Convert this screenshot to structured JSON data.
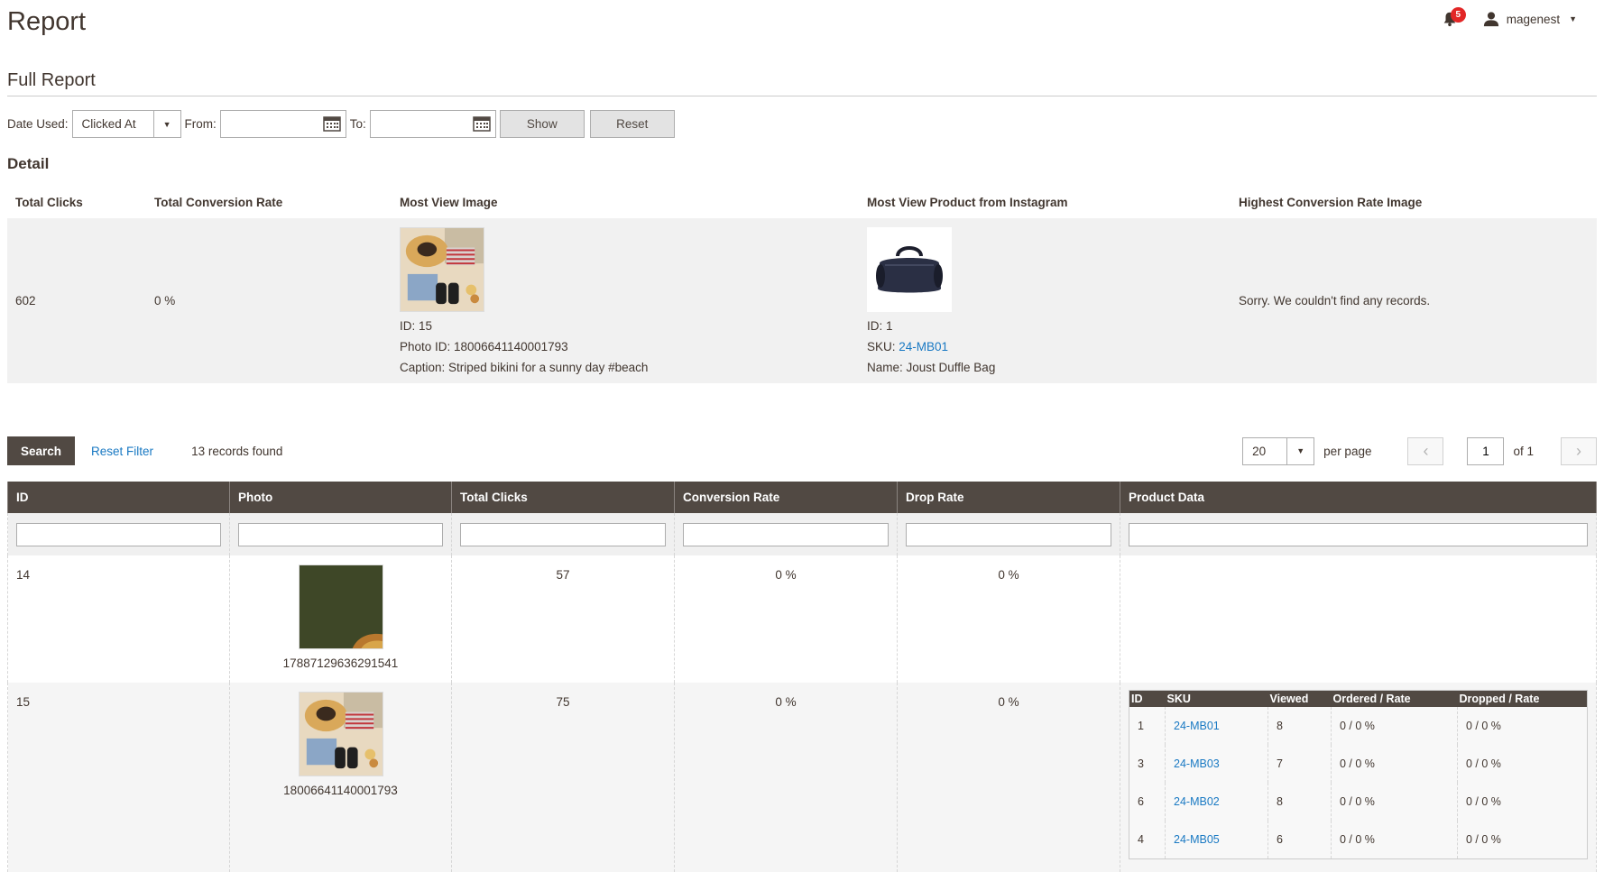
{
  "header": {
    "title": "Report",
    "notification_count": "5",
    "username": "magenest"
  },
  "section": {
    "title": "Full Report"
  },
  "filters": {
    "date_used_label": "Date Used:",
    "date_used_value": "Clicked At",
    "from_label": "From:",
    "from_value": "",
    "to_label": "To:",
    "to_value": "",
    "show_label": "Show",
    "reset_label": "Reset"
  },
  "detail": {
    "title": "Detail",
    "headers": {
      "total_clicks": "Total Clicks",
      "total_conversion_rate": "Total Conversion Rate",
      "most_view_image": "Most View Image",
      "most_view_product": "Most View Product from Instagram",
      "highest_conversion": "Highest Conversion Rate Image"
    },
    "total_clicks": "602",
    "total_conversion_rate": "0 %",
    "most_view_image": {
      "id": "ID: 15",
      "photo_id": "Photo ID: 18006641140001793",
      "caption": "Caption: Striped bikini for a sunny day #beach"
    },
    "most_view_product": {
      "id": "ID: 1",
      "sku_label": "SKU: ",
      "sku": "24-MB01",
      "name": "Name: Joust Duffle Bag"
    },
    "highest_conversion": "Sorry. We couldn't find any records."
  },
  "grid_toolbar": {
    "search_label": "Search",
    "reset_filter_label": "Reset Filter",
    "records_found": "13 records found",
    "per_page_value": "20",
    "per_page_label": "per page",
    "page_value": "1",
    "of_label": "of 1"
  },
  "grid": {
    "columns": [
      "ID",
      "Photo",
      "Total Clicks",
      "Conversion Rate",
      "Drop Rate",
      "Product Data"
    ],
    "rows": [
      {
        "id": "14",
        "photo_id": "17887129636291541",
        "total_clicks": "57",
        "conversion_rate": "0 %",
        "drop_rate": "0 %"
      },
      {
        "id": "15",
        "photo_id": "18006641140001793",
        "total_clicks": "75",
        "conversion_rate": "0 %",
        "drop_rate": "0 %",
        "product_data": {
          "columns": [
            "ID",
            "SKU",
            "Viewed",
            "Ordered / Rate",
            "Dropped / Rate"
          ],
          "rows": [
            {
              "id": "1",
              "sku": "24-MB01",
              "viewed": "8",
              "ordered": "0 / 0 %",
              "dropped": "0 / 0 %"
            },
            {
              "id": "3",
              "sku": "24-MB03",
              "viewed": "7",
              "ordered": "0 / 0 %",
              "dropped": "0 / 0 %"
            },
            {
              "id": "6",
              "sku": "24-MB02",
              "viewed": "8",
              "ordered": "0 / 0 %",
              "dropped": "0 / 0 %"
            },
            {
              "id": "4",
              "sku": "24-MB05",
              "viewed": "6",
              "ordered": "0 / 0 %",
              "dropped": "0 / 0 %"
            }
          ]
        }
      }
    ]
  },
  "icons": {
    "bell": "bell-icon",
    "user": "user-icon",
    "calendar": "calendar-icon",
    "chevron_left": "chevron-left-icon",
    "chevron_right": "chevron-right-icon",
    "dropdown": "chevron-down-icon"
  },
  "colors": {
    "header_dark": "#514943",
    "link": "#1979c3",
    "badge": "#e22626",
    "detail_bg": "#f1f1f1"
  }
}
